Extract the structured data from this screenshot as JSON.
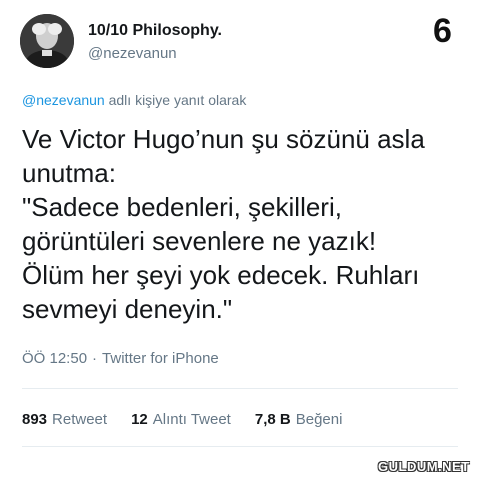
{
  "author": {
    "display_name": "10/10 Philosophy.",
    "handle": "@nezevanun"
  },
  "corner_number": "6",
  "reply_context": {
    "mention": "@nezevanun",
    "text": " adlı kişiye yanıt olarak"
  },
  "tweet": {
    "lines": [
      "Ve Victor Hugo’nun şu sözünü asla",
      "unutma:",
      "\"Sadece bedenleri, şekilleri,",
      "görüntüleri sevenlere ne yazık!",
      "Ölüm her şeyi yok edecek. Ruhları",
      "sevmeyi deneyin.\""
    ]
  },
  "meta": {
    "time": "ÖÖ 12:50",
    "separator": "·",
    "source": "Twitter for iPhone"
  },
  "stats": {
    "retweets_count": "893",
    "retweets_label": "Retweet",
    "quotes_count": "12",
    "quotes_label": "Alıntı Tweet",
    "likes_count": "7,8 B",
    "likes_label": "Beğeni"
  },
  "watermark": "GULDUM.NET"
}
